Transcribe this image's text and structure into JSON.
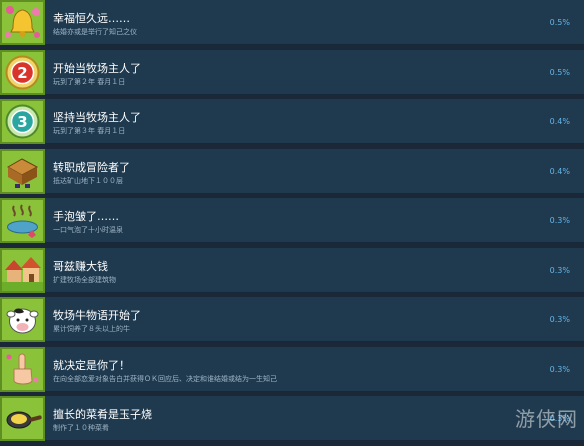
{
  "achievements": [
    {
      "title": "幸福恒久远……",
      "desc": "结婚亦或是举行了知己之仪",
      "percent": "0.5%",
      "icon": "bell-icon"
    },
    {
      "title": "开始当牧场主人了",
      "desc": "玩到了第２年 春月１日",
      "percent": "0.5%",
      "icon": "number-2-badge-icon"
    },
    {
      "title": "坚持当牧场主人了",
      "desc": "玩到了第３年 春月１日",
      "percent": "0.4%",
      "icon": "number-3-badge-icon"
    },
    {
      "title": "转职成冒险者了",
      "desc": "抵达矿山地下１００层",
      "percent": "0.4%",
      "icon": "mine-crate-icon"
    },
    {
      "title": "手泡皱了……",
      "desc": "一口气泡了十小时温泉",
      "percent": "0.3%",
      "icon": "hot-spring-icon"
    },
    {
      "title": "哥兹赚大钱",
      "desc": "扩建牧场全部建筑物",
      "percent": "0.3%",
      "icon": "farm-buildings-icon"
    },
    {
      "title": "牧场牛物语开始了",
      "desc": "累计饲养了８头以上的牛",
      "percent": "0.3%",
      "icon": "cow-icon"
    },
    {
      "title": "就决定是你了！",
      "desc": "在向全部恋爱对象告白并获得ＯＫ回应后、决定和谁结婚或结为一生知己",
      "percent": "0.3%",
      "icon": "pointing-hand-icon"
    },
    {
      "title": "擅长的菜肴是玉子烧",
      "desc": "制作了１０种菜肴",
      "percent": "0.3%",
      "icon": "frying-pan-icon"
    }
  ],
  "watermark": "游侠网"
}
